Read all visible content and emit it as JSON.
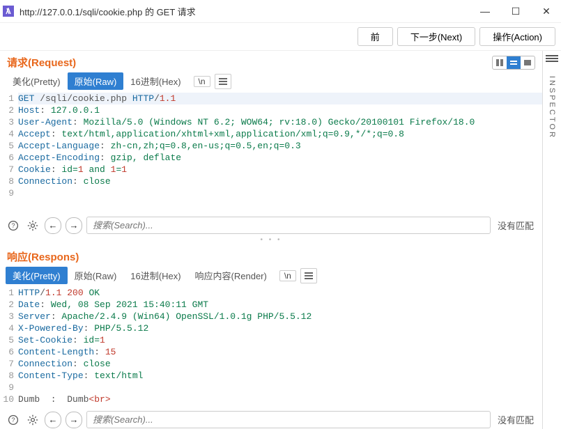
{
  "window": {
    "title": "http://127.0.0.1/sqli/cookie.php 的 GET 请求"
  },
  "toolbar": {
    "back": "前",
    "next": "下一步(Next)",
    "action": "操作(Action)"
  },
  "sidebar": {
    "label": "INSPECTOR"
  },
  "panes": {
    "request": {
      "title": "请求(Request)",
      "tabs": {
        "pretty": "美化(Pretty)",
        "raw": "原始(Raw)",
        "hex": "16进制(Hex)",
        "newline": "\\n"
      },
      "search": {
        "placeholder": "搜索(Search)...",
        "status": "没有匹配"
      },
      "lines": [
        {
          "n": "1",
          "html": "<span class='method'>GET</span><span class='plain'> /sqli/cookie.php </span><span class='method'>HTTP</span><span class='plain'>/</span><span class='num'>1.1</span>"
        },
        {
          "n": "2",
          "html": "<span class='hdrname'>Host</span><span class='plain'>: </span><span class='hdrval'>127.0.0.1</span>"
        },
        {
          "n": "3",
          "html": "<span class='hdrname'>User-Agent</span><span class='plain'>: </span><span class='hdrval'>Mozilla/5.0 (Windows NT 6.2; WOW64; rv:18.0) Gecko/20100101 Firefox/18.0</span>"
        },
        {
          "n": "4",
          "html": "<span class='hdrname'>Accept</span><span class='plain'>: </span><span class='hdrval'>text/html,application/xhtml+xml,application/xml;q=0.9,*/*;q=0.8</span>"
        },
        {
          "n": "5",
          "html": "<span class='hdrname'>Accept-Language</span><span class='plain'>: </span><span class='hdrval'>zh-cn,zh;q=0.8,en-us;q=0.5,en;q=0.3</span>"
        },
        {
          "n": "6",
          "html": "<span class='hdrname'>Accept-Encoding</span><span class='plain'>: </span><span class='hdrval'>gzip, deflate</span>"
        },
        {
          "n": "7",
          "html": "<span class='hdrname'>Cookie</span><span class='plain'>: </span><span class='hdrval'>id=</span><span class='num'>1</span><span class='hdrval'> and </span><span class='num'>1</span><span class='hdrval'>=</span><span class='num'>1</span>"
        },
        {
          "n": "8",
          "html": "<span class='hdrname'>Connection</span><span class='plain'>: </span><span class='hdrval'>close</span>"
        },
        {
          "n": "9",
          "html": "<span class='plain'></span>"
        }
      ]
    },
    "response": {
      "title": "响应(Respons)",
      "tabs": {
        "pretty": "美化(Pretty)",
        "raw": "原始(Raw)",
        "hex": "16进制(Hex)",
        "render": "响应内容(Render)",
        "newline": "\\n"
      },
      "search": {
        "placeholder": "搜索(Search)...",
        "status": "没有匹配"
      },
      "lines": [
        {
          "n": "1",
          "html": "<span class='method'>HTTP</span><span class='plain'>/</span><span class='num'>1.1</span><span class='plain'> </span><span class='num'>200</span><span class='plain'> </span><span class='hdrval'>OK</span>"
        },
        {
          "n": "2",
          "html": "<span class='hdrname'>Date</span><span class='plain'>: </span><span class='hdrval'>Wed, 08 Sep 2021 15:40:11 GMT</span>"
        },
        {
          "n": "3",
          "html": "<span class='hdrname'>Server</span><span class='plain'>: </span><span class='hdrval'>Apache/2.4.9 (Win64) OpenSSL/1.0.1g PHP/5.5.12</span>"
        },
        {
          "n": "4",
          "html": "<span class='hdrname'>X-Powered-By</span><span class='plain'>: </span><span class='hdrval'>PHP/5.5.12</span>"
        },
        {
          "n": "5",
          "html": "<span class='hdrname'>Set-Cookie</span><span class='plain'>: </span><span class='hdrval'>id=</span><span class='num'>1</span>"
        },
        {
          "n": "6",
          "html": "<span class='hdrname'>Content-Length</span><span class='plain'>: </span><span class='num'>15</span>"
        },
        {
          "n": "7",
          "html": "<span class='hdrname'>Connection</span><span class='plain'>: </span><span class='hdrval'>close</span>"
        },
        {
          "n": "8",
          "html": "<span class='hdrname'>Content-Type</span><span class='plain'>: </span><span class='hdrval'>text/html</span>"
        },
        {
          "n": "9",
          "html": "<span class='plain'></span>"
        },
        {
          "n": "10",
          "html": "<span class='plain'>Dumb  :  Dumb</span><span class='tagc'>&lt;br&gt;</span>"
        }
      ]
    }
  }
}
